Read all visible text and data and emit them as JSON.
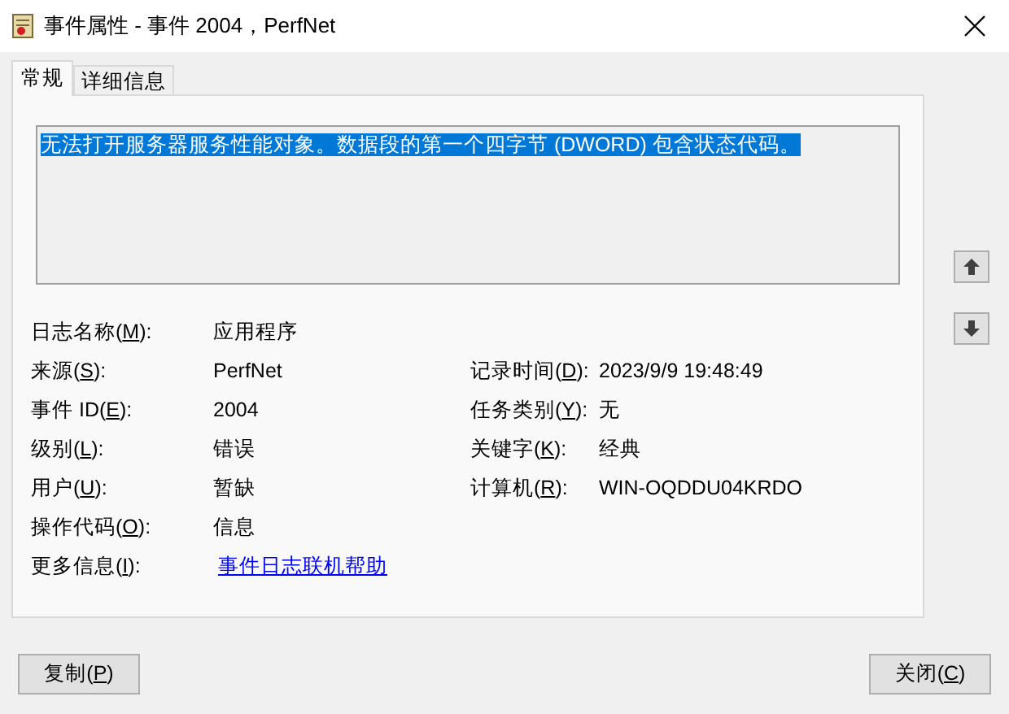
{
  "window": {
    "title": "事件属性 - 事件 2004，PerfNet"
  },
  "tabs": [
    {
      "label": "常规",
      "selected": true
    },
    {
      "label": "详细信息",
      "selected": false
    }
  ],
  "description": {
    "value": "无法打开服务器服务性能对象。数据段的第一个四字节 (DWORD) 包含状态代码。",
    "selected": true
  },
  "rows": [
    {
      "left": {
        "label": {
          "before": "日志名称(",
          "key": "M",
          "after": "):"
        },
        "value": "应用程序",
        "kind": "text"
      }
    },
    {
      "left": {
        "label": {
          "before": "来源(",
          "key": "S",
          "after": "):"
        },
        "value": "PerfNet",
        "kind": "text"
      },
      "right": {
        "label": {
          "before": "记录时间(",
          "key": "D",
          "after": "):"
        },
        "value": "2023/9/9 19:48:49",
        "kind": "text"
      }
    },
    {
      "left": {
        "label": {
          "before": "事件 ID(",
          "key": "E",
          "after": "):"
        },
        "value": "2004",
        "kind": "text"
      },
      "right": {
        "label": {
          "before": "任务类别(",
          "key": "Y",
          "after": "):"
        },
        "value": "无",
        "kind": "text"
      }
    },
    {
      "left": {
        "label": {
          "before": "级别(",
          "key": "L",
          "after": "):"
        },
        "value": "错误",
        "kind": "text"
      },
      "right": {
        "label": {
          "before": "关键字(",
          "key": "K",
          "after": "):"
        },
        "value": "经典",
        "kind": "text"
      }
    },
    {
      "left": {
        "label": {
          "before": "用户(",
          "key": "U",
          "after": "):"
        },
        "value": "暂缺",
        "kind": "text"
      },
      "right": {
        "label": {
          "before": "计算机(",
          "key": "R",
          "after": "):"
        },
        "value": "WIN-OQDDU04KRDO",
        "kind": "text"
      }
    },
    {
      "left": {
        "label": {
          "before": "操作代码(",
          "key": "O",
          "after": "):"
        },
        "value": "信息",
        "kind": "text"
      }
    },
    {
      "left": {
        "label": {
          "before": "更多信息(",
          "key": "I",
          "after": "):"
        },
        "value": "事件日志联机帮助",
        "kind": "link"
      }
    }
  ],
  "buttons": [
    {
      "label": {
        "before": "复制(",
        "key": "P",
        "after": ")"
      }
    },
    {
      "label": {
        "before": "关闭(",
        "key": "C",
        "after": ")"
      }
    }
  ]
}
